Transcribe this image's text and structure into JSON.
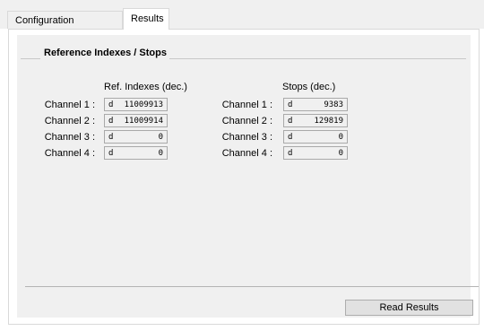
{
  "tabs": [
    {
      "label": "Configuration Registers"
    },
    {
      "label": "Results"
    }
  ],
  "group": {
    "title": "Reference Indexes / Stops"
  },
  "ref_indexes": {
    "header": "Ref. Indexes (dec.)",
    "rows": [
      {
        "label": "Channel 1 :",
        "prefix": "d",
        "value": "11009913"
      },
      {
        "label": "Channel 2 :",
        "prefix": "d",
        "value": "11009914"
      },
      {
        "label": "Channel 3 :",
        "prefix": "d",
        "value": "0"
      },
      {
        "label": "Channel 4 :",
        "prefix": "d",
        "value": "0"
      }
    ]
  },
  "stops": {
    "header": "Stops (dec.)",
    "rows": [
      {
        "label": "Channel 1 :",
        "prefix": "d",
        "value": "9383"
      },
      {
        "label": "Channel 2 :",
        "prefix": "d",
        "value": "129819"
      },
      {
        "label": "Channel 3 :",
        "prefix": "d",
        "value": "0"
      },
      {
        "label": "Channel 4 :",
        "prefix": "d",
        "value": "0"
      }
    ]
  },
  "read_button": {
    "label": "Read Results"
  }
}
